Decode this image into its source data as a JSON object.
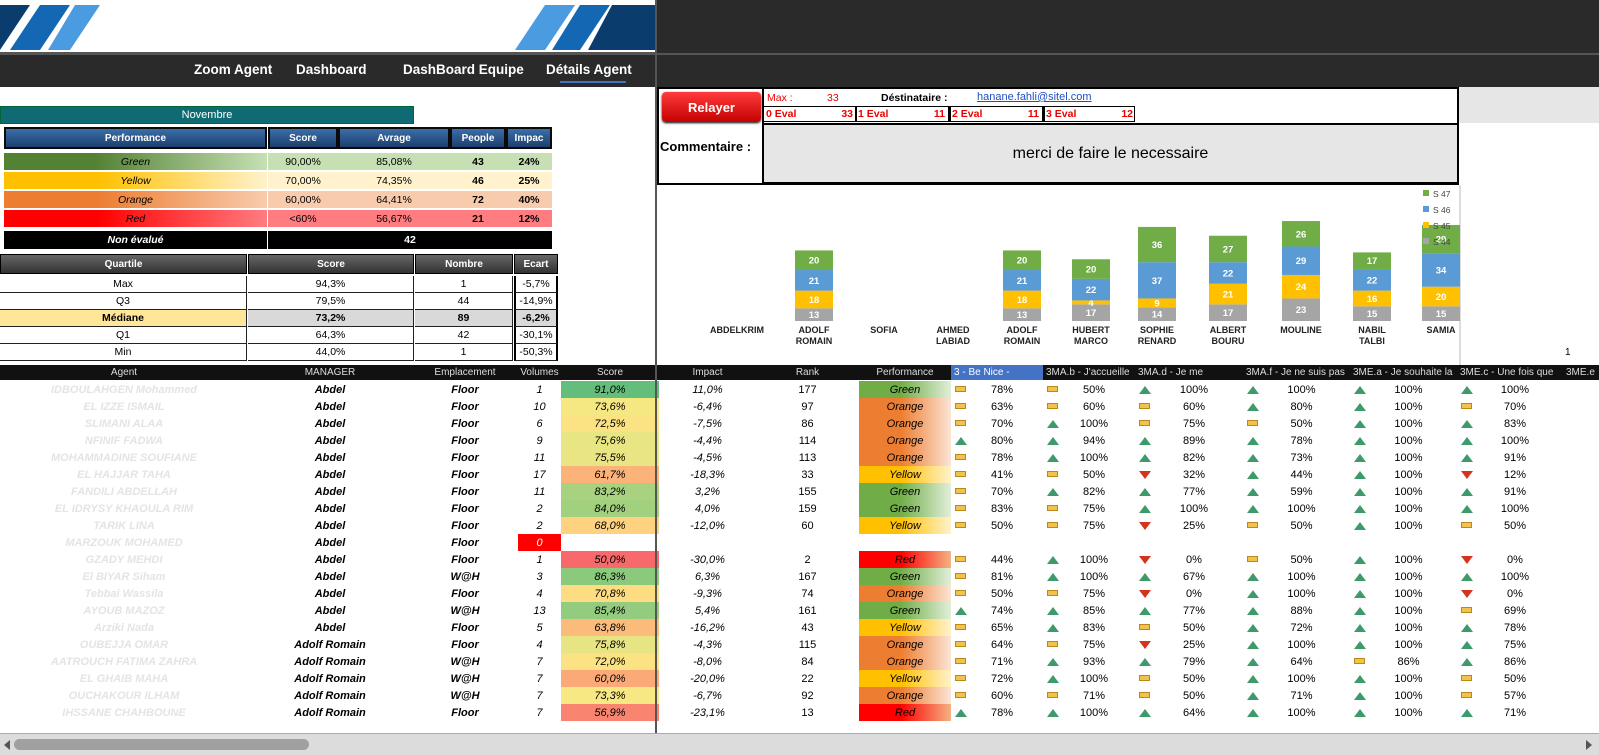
{
  "nav": {
    "items": [
      "Zoom Agent",
      "Dashboard",
      "DashBoard Equipe",
      "Détails Agent"
    ],
    "active": "Détails Agent"
  },
  "month": "Novembre",
  "perf_table": {
    "headers": [
      "Performance",
      "Score",
      "Avrage",
      "People",
      "Impac"
    ],
    "rows": [
      {
        "label": "Green",
        "score": "90,00%",
        "avg": "85,08%",
        "people": "43",
        "impact": "24%",
        "color": "#548235",
        "bg": "#c6e0b4"
      },
      {
        "label": "Yellow",
        "score": "70,00%",
        "avg": "74,35%",
        "people": "46",
        "impact": "25%",
        "color": "#ffc000",
        "bg": "#fff2cc"
      },
      {
        "label": "Orange",
        "score": "60,00%",
        "avg": "64,41%",
        "people": "72",
        "impact": "40%",
        "color": "#ed7d31",
        "bg": "#f8cbad"
      },
      {
        "label": "Red",
        "score": "<60%",
        "avg": "56,67%",
        "people": "21",
        "impact": "12%",
        "color": "#ff0000",
        "bg": "#ff7c80"
      }
    ],
    "non_evalue_label": "Non évalué",
    "non_evalue_value": "42"
  },
  "quartile_table": {
    "headers": [
      "Quartile",
      "Score",
      "Nombre",
      "Ecart"
    ],
    "rows": [
      {
        "q": "Max",
        "score": "94,3%",
        "n": "1",
        "ecart": "-5,7%"
      },
      {
        "q": "Q3",
        "score": "79,5%",
        "n": "44",
        "ecart": "-14,9%"
      },
      {
        "q": "Médiane",
        "score": "73,2%",
        "n": "89",
        "ecart": "-6,2%"
      },
      {
        "q": "Q1",
        "score": "64,3%",
        "n": "42",
        "ecart": "-30,1%"
      },
      {
        "q": "Min",
        "score": "44,0%",
        "n": "1",
        "ecart": "-50,3%"
      }
    ]
  },
  "mail": {
    "relayer": "Relayer",
    "max_label": "Max :",
    "max_value": "33",
    "dest_label": "Déstinataire :",
    "dest_email": "hanane.fahli@sitel.com",
    "evals": [
      {
        "label": "0 Eval",
        "value": "33"
      },
      {
        "label": "1 Eval",
        "value": "11"
      },
      {
        "label": "2 Eval",
        "value": "11"
      },
      {
        "label": "3 Eval",
        "value": "12"
      }
    ],
    "comment_label": "Commentaire :",
    "comment": "merci de faire le necessaire",
    "search_icon": "magnifier-icon"
  },
  "chart_data": {
    "type": "bar",
    "stacked": true,
    "categories": [
      "ABDELKRIM",
      "ADOLF ROMAIN",
      "SOFIA",
      "AHMED LABIAD",
      "ADOLF ROMAIN",
      "HUBERT MARCO",
      "SOPHIE RENARD",
      "ALBERT BOURU",
      "MOULINE",
      "NABIL TALBI",
      "SAMIA"
    ],
    "series": [
      {
        "name": "S 44",
        "color": "#a5a5a5",
        "values": [
          null,
          13,
          null,
          null,
          13,
          17,
          14,
          17,
          23,
          15,
          15
        ]
      },
      {
        "name": "S 45",
        "color": "#ffc000",
        "values": [
          null,
          18,
          null,
          null,
          18,
          4,
          9,
          21,
          24,
          16,
          20
        ]
      },
      {
        "name": "S 46",
        "color": "#5b9bd5",
        "values": [
          null,
          21,
          null,
          null,
          21,
          22,
          37,
          22,
          29,
          22,
          34
        ]
      },
      {
        "name": "S 47",
        "color": "#70ad47",
        "values": [
          null,
          20,
          null,
          null,
          20,
          20,
          36,
          27,
          26,
          17,
          29
        ]
      }
    ],
    "legend_position": "right",
    "page_number": "1"
  },
  "grid": {
    "headers": [
      "Agent",
      "MANAGER",
      "Emplacement",
      "Volumes",
      "Score",
      "Impact",
      "Rank",
      "Performance",
      "3 - Be Nice -",
      "3MA.b - J'accueille",
      "3MA.d - Je me",
      "3MA.f - Je ne suis pas",
      "3ME.a - Je souhaite la",
      "3ME.c - Une fois que",
      "3ME.e"
    ],
    "rows": [
      {
        "agent": "IDBOULAHGEN Mohammed",
        "manager": "Abdel",
        "emp": "Floor",
        "vol": "1",
        "score": "91,0%",
        "sc": "#63be7b",
        "impact": "11,0%",
        "rank": "177",
        "perf": "Green",
        "c": [
          [
            "flat",
            "78%"
          ],
          [
            "flat",
            "50%"
          ],
          [
            "up",
            "100%"
          ],
          [
            "up",
            "100%"
          ],
          [
            "up",
            "100%"
          ],
          [
            "up",
            "100%"
          ]
        ]
      },
      {
        "agent": "EL IZZE ISMAIL",
        "manager": "Abdel",
        "emp": "Floor",
        "vol": "10",
        "score": "73,6%",
        "sc": "#f5e883",
        "impact": "-6,4%",
        "rank": "97",
        "perf": "Orange",
        "c": [
          [
            "flat",
            "63%"
          ],
          [
            "flat",
            "60%"
          ],
          [
            "flat",
            "60%"
          ],
          [
            "up",
            "80%"
          ],
          [
            "up",
            "100%"
          ],
          [
            "flat",
            "70%"
          ]
        ]
      },
      {
        "agent": "SLIMANI ALAA",
        "manager": "Abdel",
        "emp": "Floor",
        "vol": "6",
        "score": "72,5%",
        "sc": "#fbe383",
        "impact": "-7,5%",
        "rank": "86",
        "perf": "Orange",
        "c": [
          [
            "flat",
            "70%"
          ],
          [
            "up",
            "100%"
          ],
          [
            "flat",
            "75%"
          ],
          [
            "flat",
            "50%"
          ],
          [
            "up",
            "100%"
          ],
          [
            "up",
            "83%"
          ]
        ]
      },
      {
        "agent": "NFINIF FADWA",
        "manager": "Abdel",
        "emp": "Floor",
        "vol": "9",
        "score": "75,6%",
        "sc": "#e8e583",
        "impact": "-4,4%",
        "rank": "114",
        "perf": "Orange",
        "c": [
          [
            "up",
            "80%"
          ],
          [
            "up",
            "94%"
          ],
          [
            "up",
            "89%"
          ],
          [
            "up",
            "78%"
          ],
          [
            "up",
            "100%"
          ],
          [
            "up",
            "100%"
          ]
        ]
      },
      {
        "agent": "MOHAMMADINE SOUFIANE",
        "manager": "Abdel",
        "emp": "Floor",
        "vol": "11",
        "score": "75,5%",
        "sc": "#e9e583",
        "impact": "-4,5%",
        "rank": "113",
        "perf": "Orange",
        "c": [
          [
            "flat",
            "78%"
          ],
          [
            "up",
            "100%"
          ],
          [
            "up",
            "82%"
          ],
          [
            "up",
            "73%"
          ],
          [
            "up",
            "100%"
          ],
          [
            "up",
            "91%"
          ]
        ]
      },
      {
        "agent": "EL HAJJAR TAHA",
        "manager": "Abdel",
        "emp": "Floor",
        "vol": "17",
        "score": "61,7%",
        "sc": "#fbb379",
        "impact": "-18,3%",
        "rank": "33",
        "perf": "Yellow",
        "c": [
          [
            "flat",
            "41%"
          ],
          [
            "flat",
            "50%"
          ],
          [
            "down",
            "32%"
          ],
          [
            "up",
            "44%"
          ],
          [
            "up",
            "100%"
          ],
          [
            "down",
            "12%"
          ]
        ]
      },
      {
        "agent": "FANDILI ABDELLAH",
        "manager": "Abdel",
        "emp": "Floor",
        "vol": "11",
        "score": "83,2%",
        "sc": "#a8d27f",
        "impact": "3,2%",
        "rank": "155",
        "perf": "Green",
        "c": [
          [
            "flat",
            "70%"
          ],
          [
            "up",
            "82%"
          ],
          [
            "up",
            "77%"
          ],
          [
            "up",
            "59%"
          ],
          [
            "up",
            "100%"
          ],
          [
            "up",
            "91%"
          ]
        ]
      },
      {
        "agent": "EL IDRYSY KHAOULA RIM",
        "manager": "Abdel",
        "emp": "Floor",
        "vol": "2",
        "score": "84,0%",
        "sc": "#a1d07f",
        "impact": "4,0%",
        "rank": "159",
        "perf": "Green",
        "c": [
          [
            "flat",
            "83%"
          ],
          [
            "flat",
            "75%"
          ],
          [
            "up",
            "100%"
          ],
          [
            "up",
            "100%"
          ],
          [
            "up",
            "100%"
          ],
          [
            "up",
            "100%"
          ]
        ]
      },
      {
        "agent": "TARIK LINA",
        "manager": "Abdel",
        "emp": "Floor",
        "vol": "2",
        "score": "68,0%",
        "sc": "#fed27f",
        "impact": "-12,0%",
        "rank": "60",
        "perf": "Yellow",
        "c": [
          [
            "flat",
            "50%"
          ],
          [
            "flat",
            "75%"
          ],
          [
            "down",
            "25%"
          ],
          [
            "flat",
            "50%"
          ],
          [
            "up",
            "100%"
          ],
          [
            "flat",
            "50%"
          ]
        ]
      },
      {
        "agent": "MARZOUK MOHAMED",
        "manager": "Abdel",
        "emp": "Floor",
        "vol": "0",
        "score": "",
        "sc": "#ffffff",
        "impact": "",
        "rank": "",
        "perf": "",
        "c": []
      },
      {
        "agent": "GZADY MEHDI",
        "manager": "Abdel",
        "emp": "Floor",
        "vol": "1",
        "score": "50,0%",
        "sc": "#f8696b",
        "impact": "-30,0%",
        "rank": "2",
        "perf": "Red",
        "c": [
          [
            "flat",
            "44%"
          ],
          [
            "up",
            "100%"
          ],
          [
            "down",
            "0%"
          ],
          [
            "flat",
            "50%"
          ],
          [
            "up",
            "100%"
          ],
          [
            "down",
            "0%"
          ]
        ]
      },
      {
        "agent": "El BIYAR Siham",
        "manager": "Abdel",
        "emp": "W@H",
        "vol": "3",
        "score": "86,3%",
        "sc": "#8bc97d",
        "impact": "6,3%",
        "rank": "167",
        "perf": "Green",
        "c": [
          [
            "flat",
            "81%"
          ],
          [
            "up",
            "100%"
          ],
          [
            "up",
            "67%"
          ],
          [
            "up",
            "100%"
          ],
          [
            "up",
            "100%"
          ],
          [
            "up",
            "100%"
          ]
        ]
      },
      {
        "agent": "Tebbai Wassila",
        "manager": "Abdel",
        "emp": "Floor",
        "vol": "4",
        "score": "70,8%",
        "sc": "#fddc82",
        "impact": "-9,3%",
        "rank": "74",
        "perf": "Orange",
        "c": [
          [
            "flat",
            "50%"
          ],
          [
            "flat",
            "75%"
          ],
          [
            "down",
            "0%"
          ],
          [
            "up",
            "100%"
          ],
          [
            "up",
            "100%"
          ],
          [
            "down",
            "0%"
          ]
        ]
      },
      {
        "agent": "AYOUB MAZOZ",
        "manager": "Abdel",
        "emp": "W@H",
        "vol": "13",
        "score": "85,4%",
        "sc": "#93cc7e",
        "impact": "5,4%",
        "rank": "161",
        "perf": "Green",
        "c": [
          [
            "up",
            "74%"
          ],
          [
            "up",
            "85%"
          ],
          [
            "up",
            "77%"
          ],
          [
            "up",
            "88%"
          ],
          [
            "up",
            "100%"
          ],
          [
            "flat",
            "69%"
          ]
        ]
      },
      {
        "agent": "Arziki Nada",
        "manager": "Abdel",
        "emp": "Floor",
        "vol": "5",
        "score": "63,8%",
        "sc": "#fbbb7a",
        "impact": "-16,2%",
        "rank": "43",
        "perf": "Yellow",
        "c": [
          [
            "flat",
            "65%"
          ],
          [
            "up",
            "83%"
          ],
          [
            "flat",
            "50%"
          ],
          [
            "up",
            "72%"
          ],
          [
            "up",
            "100%"
          ],
          [
            "up",
            "78%"
          ]
        ]
      },
      {
        "agent": "OUBEJJA OMAR",
        "manager": "Adolf Romain",
        "emp": "Floor",
        "vol": "4",
        "score": "75,8%",
        "sc": "#e7e583",
        "impact": "-4,3%",
        "rank": "115",
        "perf": "Orange",
        "c": [
          [
            "flat",
            "64%"
          ],
          [
            "flat",
            "75%"
          ],
          [
            "down",
            "25%"
          ],
          [
            "up",
            "100%"
          ],
          [
            "up",
            "100%"
          ],
          [
            "up",
            "75%"
          ]
        ]
      },
      {
        "agent": "AATROUCH FATIMA ZAHRA",
        "manager": "Adolf Romain",
        "emp": "W@H",
        "vol": "7",
        "score": "72,0%",
        "sc": "#fbe283",
        "impact": "-8,0%",
        "rank": "84",
        "perf": "Orange",
        "c": [
          [
            "flat",
            "71%"
          ],
          [
            "up",
            "93%"
          ],
          [
            "up",
            "79%"
          ],
          [
            "up",
            "64%"
          ],
          [
            "flat",
            "86%"
          ],
          [
            "up",
            "86%"
          ]
        ]
      },
      {
        "agent": "EL GHAIB MAHA",
        "manager": "Adolf Romain",
        "emp": "W@H",
        "vol": "7",
        "score": "60,0%",
        "sc": "#fbaa77",
        "impact": "-20,0%",
        "rank": "22",
        "perf": "Yellow",
        "c": [
          [
            "flat",
            "72%"
          ],
          [
            "up",
            "100%"
          ],
          [
            "flat",
            "50%"
          ],
          [
            "up",
            "100%"
          ],
          [
            "up",
            "100%"
          ],
          [
            "flat",
            "50%"
          ]
        ]
      },
      {
        "agent": "OUCHAKOUR ILHAM",
        "manager": "Adolf Romain",
        "emp": "W@H",
        "vol": "7",
        "score": "73,3%",
        "sc": "#f7e883",
        "impact": "-6,7%",
        "rank": "92",
        "perf": "Orange",
        "c": [
          [
            "flat",
            "60%"
          ],
          [
            "flat",
            "71%"
          ],
          [
            "flat",
            "50%"
          ],
          [
            "up",
            "71%"
          ],
          [
            "up",
            "100%"
          ],
          [
            "flat",
            "57%"
          ]
        ]
      },
      {
        "agent": "IHSSANE CHAHBOUNE",
        "manager": "Adolf Romain",
        "emp": "Floor",
        "vol": "7",
        "score": "56,9%",
        "sc": "#f98570",
        "impact": "-23,1%",
        "rank": "13",
        "perf": "Red",
        "c": [
          [
            "up",
            "78%"
          ],
          [
            "up",
            "100%"
          ],
          [
            "up",
            "64%"
          ],
          [
            "up",
            "100%"
          ],
          [
            "up",
            "100%"
          ],
          [
            "up",
            "71%"
          ]
        ]
      }
    ]
  }
}
